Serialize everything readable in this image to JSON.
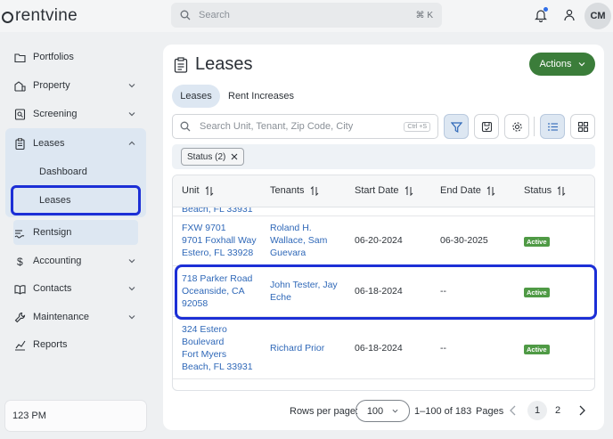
{
  "app": {
    "logo_text": "rentvine"
  },
  "topbar": {
    "search_placeholder": "Search",
    "search_shortcut": "⌘ K",
    "avatar_initials": "CM"
  },
  "sidebar": {
    "items": [
      {
        "label": "Portfolios",
        "icon": "folder-icon",
        "expandable": false
      },
      {
        "label": "Property",
        "icon": "building-icon",
        "expandable": true
      },
      {
        "label": "Screening",
        "icon": "screening-icon",
        "expandable": true
      },
      {
        "label": "Leases",
        "icon": "clipboard-icon",
        "expandable": true,
        "expanded": true
      },
      {
        "label": "Rentsign",
        "icon": "signature-icon",
        "expandable": false
      },
      {
        "label": "Accounting",
        "icon": "dollar-icon",
        "expandable": true
      },
      {
        "label": "Contacts",
        "icon": "book-icon",
        "expandable": true
      },
      {
        "label": "Maintenance",
        "icon": "wrench-icon",
        "expandable": true
      },
      {
        "label": "Reports",
        "icon": "chart-icon",
        "expandable": false
      }
    ],
    "leases_sub": {
      "dashboard": "Dashboard",
      "leases": "Leases"
    },
    "clock": "123 PM"
  },
  "page": {
    "title": "Leases",
    "actions_label": "Actions",
    "tabs": [
      {
        "label": "Leases",
        "active": true
      },
      {
        "label": "Rent Increases",
        "active": false
      }
    ],
    "search_placeholder": "Search Unit, Tenant, Zip Code, City",
    "search_shortcut": "Ctrl +S",
    "filter_chip": "Status (2)"
  },
  "table": {
    "columns": [
      "Unit",
      "Tenants",
      "Start Date",
      "End Date",
      "Status"
    ],
    "partial_top": "Beach, FL 33931",
    "rows": [
      {
        "unit": [
          "FXW 9701",
          "9701 Foxhall Way",
          "Estero, FL 33928"
        ],
        "tenants": [
          "Roland H.",
          "Wallace, Sam",
          "Guevara"
        ],
        "start": "06-20-2024",
        "end": "06-30-2025",
        "status": "Active"
      },
      {
        "unit": [
          "718 Parker Road",
          "Oceanside, CA",
          "92058"
        ],
        "tenants": [
          "John Tester, Jay",
          "Eche"
        ],
        "start": "06-18-2024",
        "end": "--",
        "status": "Active"
      },
      {
        "unit": [
          "324 Estero",
          "Boulevard",
          "Fort Myers",
          "Beach, FL 33931"
        ],
        "tenants": [
          "Richard Prior"
        ],
        "start": "06-18-2024",
        "end": "--",
        "status": "Active"
      }
    ]
  },
  "pagination": {
    "rows_per_page_label": "Rows per page:",
    "rows_per_page": "100",
    "range": "1–100 of 183",
    "pages_label": "Pages",
    "pages": [
      "1",
      "2"
    ],
    "current_page": "1"
  },
  "colors": {
    "accent_green": "#3b7d3a",
    "link_blue": "#2f68b8",
    "highlight_blue": "#1c2fd6",
    "active_badge": "#4f9a45"
  }
}
